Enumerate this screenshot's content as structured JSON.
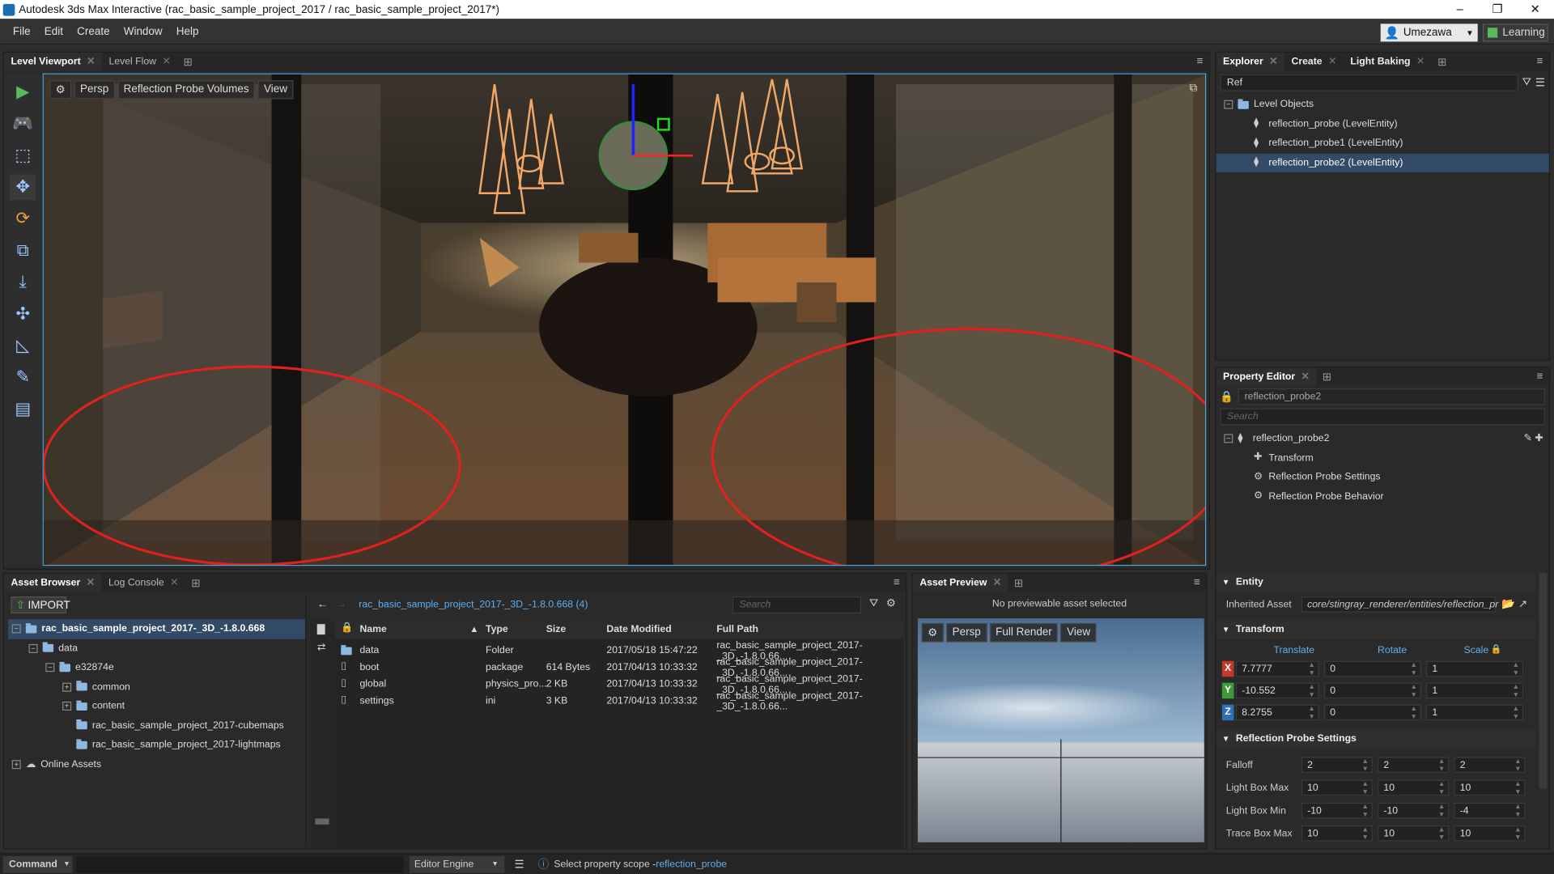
{
  "app": {
    "title": "Autodesk 3ds Max Interactive (rac_basic_sample_project_2017 / rac_basic_sample_project_2017*)",
    "window_controls": [
      "–",
      "❐",
      "✕"
    ]
  },
  "menu": [
    "File",
    "Edit",
    "Create",
    "Window",
    "Help"
  ],
  "user": {
    "name": "Umezawa",
    "learning_label": "Learning"
  },
  "viewport_panel": {
    "tabs": [
      "Level Viewport",
      "Level Flow"
    ],
    "toolbar": {
      "persp": "Persp",
      "mode": "Reflection Probe Volumes",
      "view": "View"
    }
  },
  "explorer": {
    "tabs": [
      "Explorer",
      "Create",
      "Light Baking"
    ],
    "filter_value": "Ref",
    "root": "Level Objects",
    "items": [
      "reflection_probe (LevelEntity)",
      "reflection_probe1 (LevelEntity)",
      "reflection_probe2 (LevelEntity)"
    ],
    "selected_index": 2
  },
  "property_editor": {
    "tab": "Property Editor",
    "name_value": "reflection_probe2",
    "search_placeholder": "Search",
    "root": "reflection_probe2",
    "components": [
      "Transform",
      "Reflection Probe Settings",
      "Reflection Probe Behavior"
    ],
    "entity_section": "Entity",
    "inherited_asset_label": "Inherited Asset",
    "inherited_asset_value": "core/stingray_renderer/entities/reflection_pr",
    "transform_section": "Transform",
    "columns": {
      "translate": "Translate",
      "rotate": "Rotate",
      "scale": "Scale"
    },
    "rows": [
      {
        "axis": "X",
        "color": "#c0392b",
        "translate": "7.7777",
        "rotate": "0",
        "scale": "1"
      },
      {
        "axis": "Y",
        "color": "#3c9a3c",
        "translate": "-10.552",
        "rotate": "0",
        "scale": "1"
      },
      {
        "axis": "Z",
        "color": "#2f6fb3",
        "translate": "8.2755",
        "rotate": "0",
        "scale": "1"
      }
    ],
    "probe_section": "Reflection Probe Settings",
    "probe_rows": [
      {
        "label": "Falloff",
        "v": [
          "2",
          "2",
          "2"
        ]
      },
      {
        "label": "Light Box Max",
        "v": [
          "10",
          "10",
          "10"
        ]
      },
      {
        "label": "Light Box Min",
        "v": [
          "-10",
          "-10",
          "-4"
        ]
      },
      {
        "label": "Trace Box Max",
        "v": [
          "10",
          "10",
          "10"
        ]
      }
    ]
  },
  "asset_browser": {
    "tabs": [
      "Asset Browser",
      "Log Console"
    ],
    "import_label": "IMPORT",
    "tree": [
      {
        "label": "rac_basic_sample_project_2017-_3D_-1.8.0.668",
        "depth": 0,
        "sel": true
      },
      {
        "label": "data",
        "depth": 1
      },
      {
        "label": "e32874e",
        "depth": 2
      },
      {
        "label": "common",
        "depth": 3
      },
      {
        "label": "content",
        "depth": 3
      },
      {
        "label": "rac_basic_sample_project_2017-cubemaps",
        "depth": 3
      },
      {
        "label": "rac_basic_sample_project_2017-lightmaps",
        "depth": 3
      },
      {
        "label": "Online Assets",
        "depth": 0
      }
    ],
    "path": "rac_basic_sample_project_2017-_3D_-1.8.0.668 (4)",
    "search_placeholder": "Search",
    "columns": [
      "Name",
      "Type",
      "Size",
      "Date Modified",
      "Full Path"
    ],
    "files": [
      {
        "name": "data",
        "type": "Folder",
        "size": "",
        "date": "2017/05/18 15:47:22",
        "path": "rac_basic_sample_project_2017-_3D_-1.8.0.66..."
      },
      {
        "name": "boot",
        "type": "package",
        "size": "614 Bytes",
        "date": "2017/04/13 10:33:32",
        "path": "rac_basic_sample_project_2017-_3D_-1.8.0.66..."
      },
      {
        "name": "global",
        "type": "physics_pro...",
        "size": "2 KB",
        "date": "2017/04/13 10:33:32",
        "path": "rac_basic_sample_project_2017-_3D_-1.8.0.66..."
      },
      {
        "name": "settings",
        "type": "ini",
        "size": "3 KB",
        "date": "2017/04/13 10:33:32",
        "path": "rac_basic_sample_project_2017-_3D_-1.8.0.66..."
      }
    ]
  },
  "asset_preview": {
    "tab": "Asset Preview",
    "message": "No previewable asset selected",
    "toolbar": {
      "persp": "Persp",
      "render": "Full Render",
      "view": "View"
    }
  },
  "status": {
    "command_label": "Command",
    "engine_label": "Editor Engine",
    "message_prefix": "Select property scope - ",
    "message_link": "reflection_probe"
  }
}
